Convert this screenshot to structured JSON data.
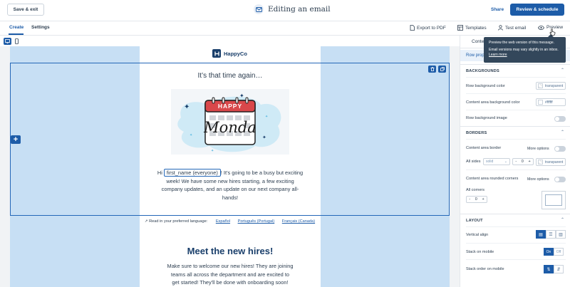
{
  "header": {
    "save_exit_label": "Save & exit",
    "title": "Editing an email",
    "share_label": "Share",
    "review_label": "Review & schedule"
  },
  "subnav": {
    "tabs": [
      {
        "label": "Create",
        "active": true
      },
      {
        "label": "Settings",
        "active": false
      }
    ],
    "tools": [
      {
        "label": "Export to PDF",
        "icon": "pdf-icon"
      },
      {
        "label": "Templates",
        "icon": "templates-icon"
      },
      {
        "label": "Test email",
        "icon": "person-icon"
      },
      {
        "label": "Preview",
        "icon": "eye-icon"
      }
    ]
  },
  "email": {
    "logo_text": "HappyCo",
    "headline": "It’s that time again…",
    "hero_top_text": "HAPPY",
    "hero_script_text": "Monda",
    "intro_prefix": "Hi",
    "merge_tag": "first_name (everyone)",
    "intro_suffix": "! It’s going to be a busy but exciting week! We have some new hires starting, a few exciting company updates, and an update on our next company all-hands!",
    "language_label": "Read in your preferred language:",
    "languages": [
      "Español",
      "Português (Portugal)",
      "Français (Canada)"
    ],
    "meet_title": "Meet the new hires!",
    "meet_body": "Make sure to welcome our new hires! They are joining teams all across the department and are excited to get started! They'll be done with onboarding soon!"
  },
  "panel": {
    "tab_content": "Content",
    "row_properties": "Row properties",
    "backgrounds_title": "BACKGROUNDS",
    "row_bg_label": "Row background color",
    "row_bg_value": "transparent",
    "content_bg_label": "Content area background color",
    "content_bg_value": "#ffffff",
    "row_bg_image_label": "Row background image",
    "borders_title": "BORDERS",
    "content_border_label": "Content area border",
    "more_options": "More options",
    "all_sides_label": "All sides",
    "border_style": "solid",
    "border_width": "0",
    "border_color": "transparent",
    "rounded_label": "Content area rounded corners",
    "all_corners_label": "All corners",
    "corner_value": "0",
    "layout_title": "LAYOUT",
    "vertical_align_label": "Vertical align",
    "stack_mobile_label": "Stack on mobile",
    "on_label": "On",
    "off_label": "Off",
    "stack_order_label": "Stack order on mobile"
  },
  "tooltip": {
    "line1": "Preview the web version of this message.",
    "line2": "Email versions may vary slightly in an inbox.",
    "link": "Learn more"
  },
  "colors": {
    "accent": "#1d5ca8",
    "navy": "#1a3f6b",
    "selection_band": "#c7dff4"
  }
}
